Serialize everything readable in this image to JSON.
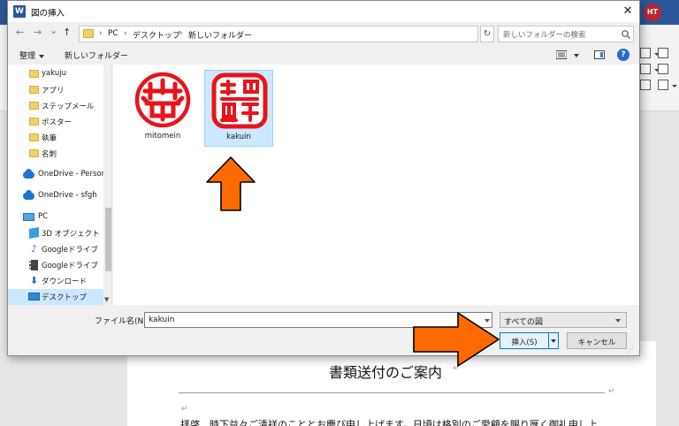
{
  "word": {
    "avatar_initials": "HT",
    "doc_title": "書類送付のご案内",
    "para_mark": "↵",
    "body_text": "拝啓　時下益々ご清祥のこととお慶び申し上げます。日頃は格別のご愛顧を賜り厚く御礼申し上"
  },
  "dialog": {
    "app_icon": "W",
    "title": "図の挿入",
    "close": "✕",
    "nav": {
      "back": "←",
      "forward": "→",
      "recent": "⌄",
      "up": "↑"
    },
    "breadcrumb": [
      "PC",
      "デスクトップ",
      "新しいフォルダー"
    ],
    "breadcrumb_sep": "›",
    "refresh": "↻",
    "search_placeholder": "新しいフォルダーの検索",
    "toolbar": {
      "organize": "整理",
      "new_folder": "新しいフォルダー",
      "help": "?"
    },
    "sidebar": {
      "items": [
        {
          "label": "yakuju",
          "icon": "folder-icon"
        },
        {
          "label": "アプリ",
          "icon": "folder-icon"
        },
        {
          "label": "ステップメール",
          "icon": "folder-icon"
        },
        {
          "label": "ポスター",
          "icon": "folder-icon"
        },
        {
          "label": "執筆",
          "icon": "folder-icon"
        },
        {
          "label": "名刺",
          "icon": "folder-icon"
        },
        {
          "label": "OneDrive - Persor",
          "icon": "onedrive-icon"
        },
        {
          "label": "OneDrive - sfgh",
          "icon": "onedrive-icon"
        },
        {
          "label": "PC",
          "icon": "pc-icon"
        },
        {
          "label": "3D オブジェクト",
          "icon": "3d-objects-icon"
        },
        {
          "label": "Googleドライブ",
          "icon": "music-icon"
        },
        {
          "label": "Googleドライブ",
          "icon": "video-icon"
        },
        {
          "label": "ダウンロード",
          "icon": "download-icon"
        },
        {
          "label": "デスクトップ",
          "icon": "desktop-icon"
        }
      ],
      "scroll_down": "▼"
    },
    "files": [
      {
        "name": "mitomein",
        "selected": false,
        "stamp_color": "#e8141b"
      },
      {
        "name": "kakuin",
        "selected": true,
        "stamp_color": "#e8141b"
      }
    ],
    "annotation_color": "#ff6a00",
    "filename_label": "ファイル名(N):",
    "filename_value": "kakuin",
    "filetype_value": "すべての図",
    "insert_label": "挿入(S)",
    "cancel_label": "キャンセル",
    "grip": "⋰"
  }
}
